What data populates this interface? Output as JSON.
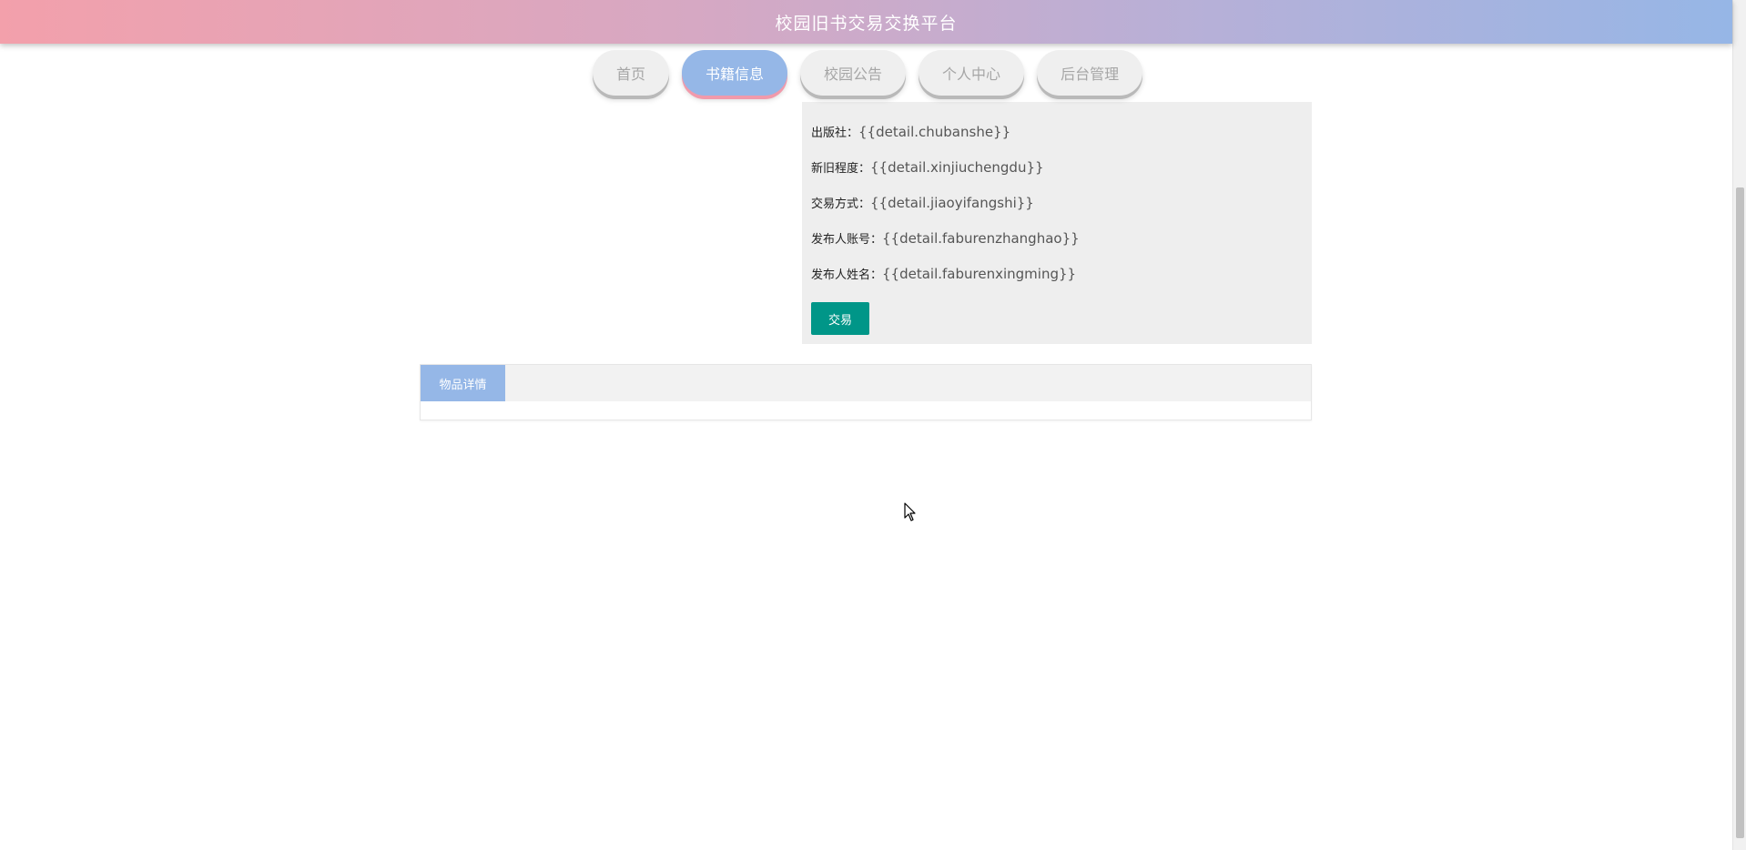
{
  "header": {
    "title": "校园旧书交易交换平台"
  },
  "nav": {
    "items": [
      {
        "label": "首页",
        "active": false
      },
      {
        "label": "书籍信息",
        "active": true
      },
      {
        "label": "校园公告",
        "active": false
      },
      {
        "label": "个人中心",
        "active": false
      },
      {
        "label": "后台管理",
        "active": false
      }
    ]
  },
  "info": {
    "rows": [
      {
        "label": "出版社：",
        "value": "{{detail.chubanshe}}"
      },
      {
        "label": "新旧程度：",
        "value": "{{detail.xinjiuchengdu}}"
      },
      {
        "label": "交易方式：",
        "value": "{{detail.jiaoyifangshi}}"
      },
      {
        "label": "发布人账号：",
        "value": "{{detail.faburenzhanghao}}"
      },
      {
        "label": "发布人姓名：",
        "value": "{{detail.faburenxingming}}"
      }
    ],
    "trade_button": "交易"
  },
  "details": {
    "tab_label": "物品详情"
  },
  "colors": {
    "accent_blue": "#95b7e7",
    "accent_pink": "#f19aab",
    "button_green": "#009688"
  }
}
